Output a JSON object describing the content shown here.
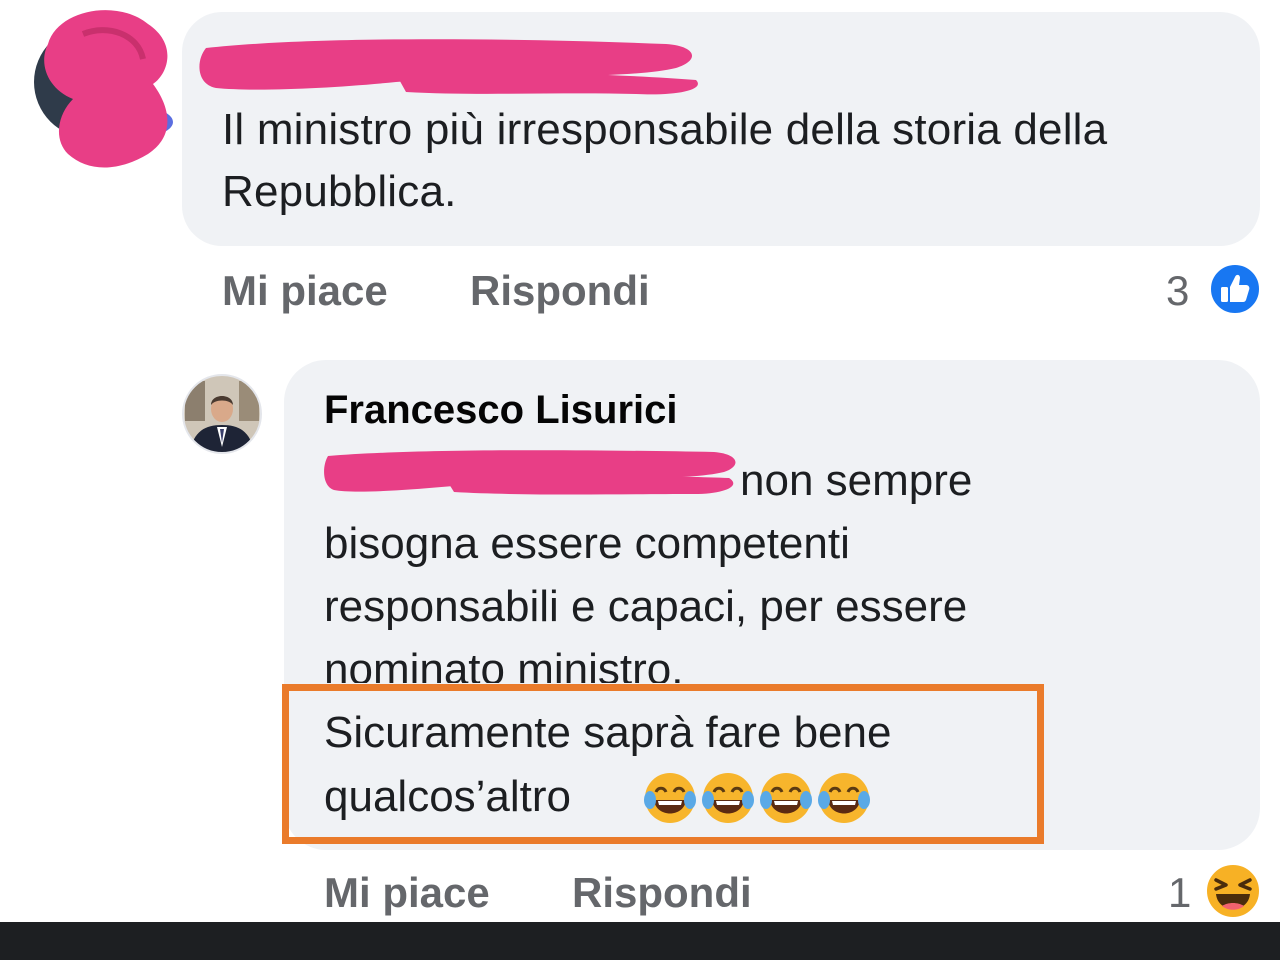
{
  "comments": [
    {
      "author_redacted": true,
      "text": "Il ministro più irresponsabile della storia della Repubblica.",
      "actions": {
        "like": "Mi piace",
        "reply": "Rispondi"
      },
      "reaction_count": "3",
      "reaction_type": "like-icon"
    }
  ],
  "reply": {
    "author": "Francesco Lisurici",
    "lines": [
      "non sempre",
      "bisogna essere competenti",
      "responsabili e capaci, per essere",
      "nominato ministro."
    ],
    "highlighted_lines": [
      "Sicuramente saprà fare bene",
      "qualcos’altro"
    ],
    "emoji_count": 4,
    "actions": {
      "like": "Mi piace",
      "reply": "Rispondi"
    },
    "reaction_count": "1",
    "reaction_type": "haha-icon"
  },
  "colors": {
    "bubble": "#f0f2f5",
    "redaction": "#e83e86",
    "highlight_border": "#ea7b2b",
    "like_blue": "#1877f2",
    "action_grey": "#65676b"
  }
}
